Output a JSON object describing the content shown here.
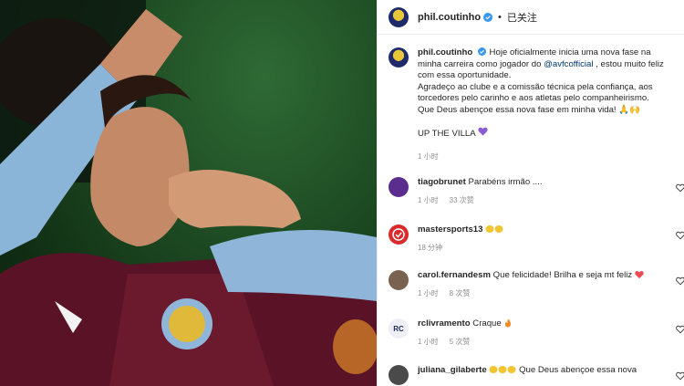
{
  "post": {
    "author": "phil.coutinho",
    "follow_status": "已关注",
    "separator": "•",
    "caption": {
      "username": "phil.coutinho",
      "line1_before": " Hoje oficialmente inicia uma nova fase na minha carreira como jogador do ",
      "mention": "@avfcofficial",
      "line1_after": " , estou muito feliz com essa oportunidade.",
      "line2": "Agradeço ao clube e a comissão técnica pela confiança, aos torcedores pelo carinho e aos atletas pelo companheirismo.",
      "line3": "Que Deus abençoe essa nova fase em minha vida! 🙏🙌",
      "line4": "UP THE VILLA",
      "time": "1 小时"
    }
  },
  "comments": [
    {
      "username": "tiagobrunet",
      "text": "Parabéns irmão ....",
      "time": "1 小时",
      "likes": "33 次赞",
      "avatar_icon": "tiago-avatar"
    },
    {
      "username": "mastersports13",
      "text": "",
      "time": "18 分钟",
      "likes": "",
      "avatar_icon": "mastersports-logo"
    },
    {
      "username": "carol.fernandesm",
      "text": "Que felicidade! Brilha e seja mt feliz",
      "time": "1 小时",
      "likes": "8 次赞",
      "avatar_icon": "carol-avatar"
    },
    {
      "username": "rclivramento",
      "text": "Craque",
      "time": "1 小时",
      "likes": "5 次赞",
      "avatar_icon": "rc-logo",
      "avatar_text": "RC"
    },
    {
      "username": "juliana_gilaberte",
      "text": "Que Deus abençoe essa nova",
      "time": "",
      "likes": "",
      "avatar_icon": "juliana-avatar"
    }
  ],
  "colors": {
    "link": "#00376b",
    "verified": "#3897f0",
    "meta": "#8e8e8e",
    "heart": "#ed4956",
    "purple_heart": "#8a5cd6"
  }
}
